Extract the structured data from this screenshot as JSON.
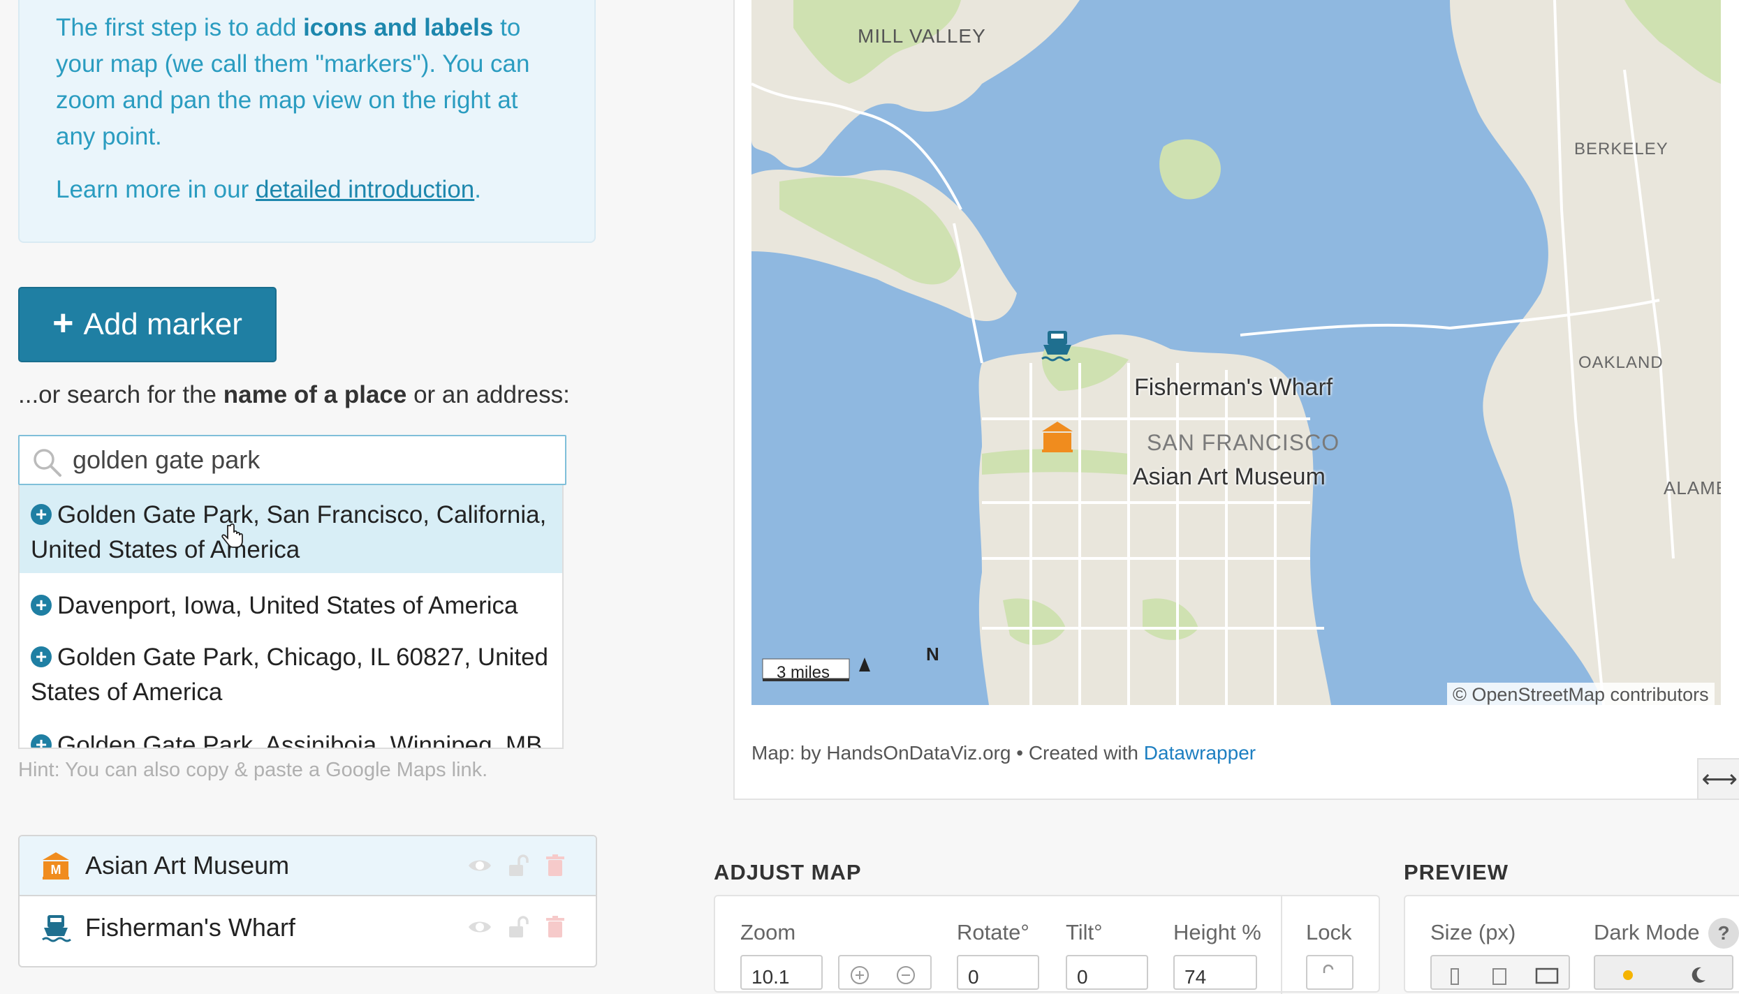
{
  "intro": {
    "line_prefix": "The first step is to add ",
    "line_bold": "icons and labels",
    "line_rest": " to your map (we call them \"markers\"). You can zoom and pan the map view on the right at any point.",
    "learn_prefix": "Learn more in our ",
    "learn_link": "detailed introduction",
    "learn_suffix": "."
  },
  "add_marker": {
    "plus": "+",
    "label": "Add marker"
  },
  "search_hint": {
    "prefix": "...or search for the ",
    "bold": "name of a place",
    "suffix": " or an address:"
  },
  "search": {
    "value": "golden gate park"
  },
  "results": [
    "Golden Gate Park, San Francisco, California, United States of America",
    "Davenport, Iowa, United States of America",
    "Golden Gate Park, Chicago, IL 60827, United States of America",
    "Golden Gate Park, Assiniboia, Winnipeg, MB,"
  ],
  "hint": "Hint: You can also copy & paste a Google Maps link.",
  "markers": [
    {
      "label": "Asian Art Museum",
      "icon": "museum-icon",
      "color": "#f08c1e"
    },
    {
      "label": "Fisherman's Wharf",
      "icon": "ferry-icon",
      "color": "#1f6f8f"
    }
  ],
  "map": {
    "labels": {
      "mill_valley": "MILL VALLEY",
      "berkeley": "BERKELEY",
      "oakland": "OAKLAND",
      "alameda": "ALAMED",
      "san_francisco": "SAN FRANCISCO",
      "fishermans_wharf": "Fisherman's Wharf",
      "asian_art_museum": "Asian Art Museum"
    },
    "scale": "3 miles",
    "north": "N",
    "credit": "© OpenStreetMap contributors",
    "byline_prefix": "Map: by HandsOnDataViz.org • Created with ",
    "byline_link": "Datawrapper",
    "resize": "⟷"
  },
  "adjust_map": {
    "title": "ADJUST MAP",
    "zoom_label": "Zoom",
    "zoom_value": "10.1",
    "rotate_label": "Rotate°",
    "rotate_value": "0",
    "tilt_label": "Tilt°",
    "tilt_value": "0",
    "height_label": "Height %",
    "height_value": "74",
    "lock_label": "Lock"
  },
  "preview": {
    "title": "PREVIEW",
    "size_label": "Size (px)",
    "dark_mode_label": "Dark Mode",
    "help": "?"
  },
  "colors": {
    "accent": "#1f7fa3",
    "water": "#8fb8e0",
    "land": "#e9e6dc",
    "park": "#cfe1b1"
  }
}
